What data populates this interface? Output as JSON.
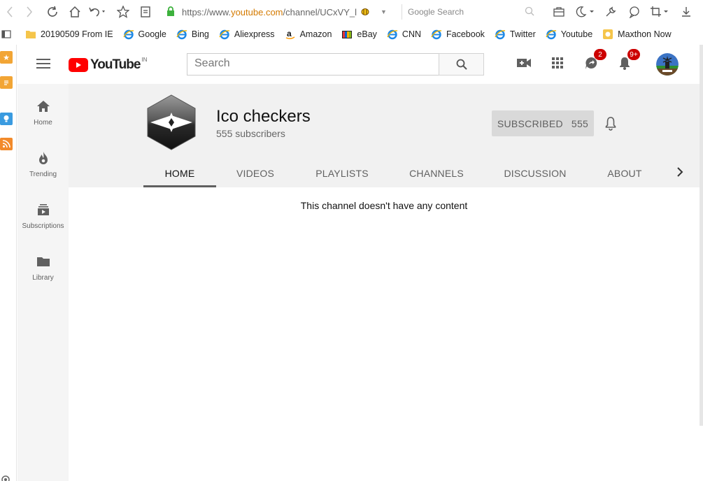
{
  "browser": {
    "url_prefix": "https://www.",
    "url_host": "youtube.com",
    "url_path": "/channel/UCxVY_l",
    "search_placeholder": "Google Search"
  },
  "bookmarks": [
    {
      "label": "20190509 From IE",
      "icon": "folder-icon"
    },
    {
      "label": "Google",
      "icon": "ie-icon"
    },
    {
      "label": "Bing",
      "icon": "ie-icon"
    },
    {
      "label": "Aliexpress",
      "icon": "ie-icon"
    },
    {
      "label": "Amazon",
      "icon": "amazon-icon"
    },
    {
      "label": "eBay",
      "icon": "ebay-icon"
    },
    {
      "label": "CNN",
      "icon": "ie-icon"
    },
    {
      "label": "Facebook",
      "icon": "ie-icon"
    },
    {
      "label": "Twitter",
      "icon": "ie-icon"
    },
    {
      "label": "Youtube",
      "icon": "ie-icon"
    },
    {
      "label": "Maxthon Now",
      "icon": "maxthon-icon"
    }
  ],
  "youtube": {
    "logo_text": "YouTube",
    "country_code": "IN",
    "search_placeholder": "Search",
    "messages_badge": "2",
    "notifications_badge": "9+"
  },
  "guide": [
    {
      "label": "Home",
      "icon": "home-icon"
    },
    {
      "label": "Trending",
      "icon": "trending-icon"
    },
    {
      "label": "Subscriptions",
      "icon": "subscriptions-icon"
    },
    {
      "label": "Library",
      "icon": "library-icon"
    }
  ],
  "channel": {
    "name": "Ico checkers",
    "subscribers_text": "555 subscribers",
    "subscribe_label": "SUBSCRIBED",
    "subscribe_count": "555",
    "tabs": [
      "HOME",
      "VIDEOS",
      "PLAYLISTS",
      "CHANNELS",
      "DISCUSSION",
      "ABOUT"
    ],
    "active_tab": "HOME",
    "empty_message": "This channel doesn't have any content"
  },
  "colors": {
    "youtube_red": "#ff0000",
    "badge_red": "#cc0000",
    "maxthon_accent": "#f2a535"
  }
}
